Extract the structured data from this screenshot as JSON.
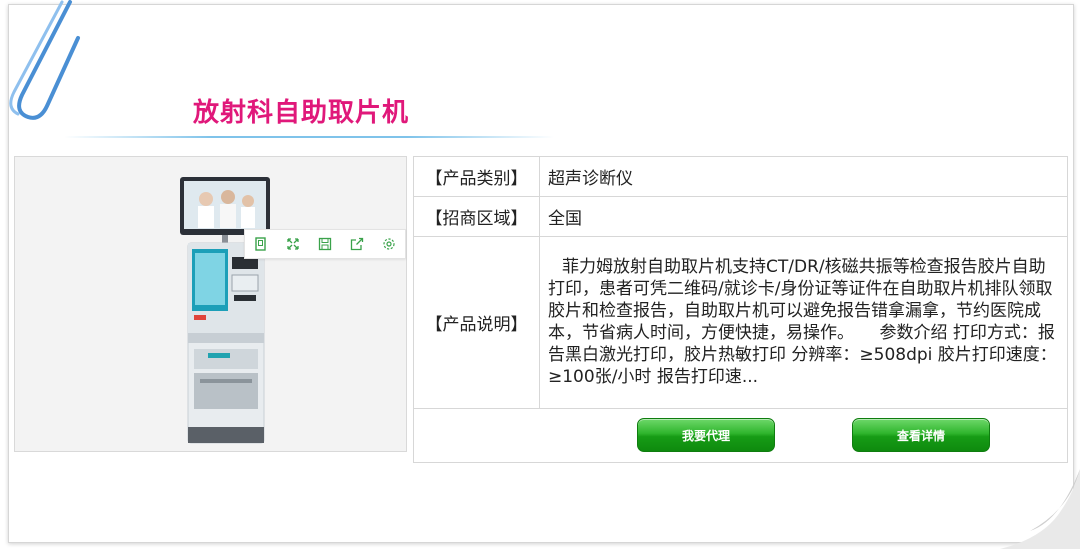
{
  "page": {
    "title": "放射科自助取片机"
  },
  "toolbar": {
    "icons": [
      "copy-icon",
      "expand-icon",
      "save-icon",
      "share-icon",
      "gear-icon"
    ]
  },
  "product": {
    "category_label": "【产品类别】",
    "category_value": "超声诊断仪",
    "region_label": "【招商区域】",
    "region_value": "全国",
    "desc_label": "【产品说明】",
    "desc_value": "菲力姆放射自助取片机支持CT/DR/核磁共振等检查报告胶片自助打印，患者可凭二维码/就诊卡/身份证等证件在自助取片机排队领取胶片和检查报告，自助取片机可以避免报告错拿漏拿，节约医院成本，节省病人时间，方便快捷，易操作。　　参数介绍 打印方式：报告黑白激光打印，胶片热敏打印 分辨率：≥508dpi 胶片打印速度：≥100张/小时 报告打印速..."
  },
  "actions": {
    "agent_label": "我要代理",
    "details_label": "查看详情"
  },
  "colors": {
    "title": "#e0187a",
    "button_green": "#1fa51e",
    "accent_blue": "#7fc3ea"
  }
}
